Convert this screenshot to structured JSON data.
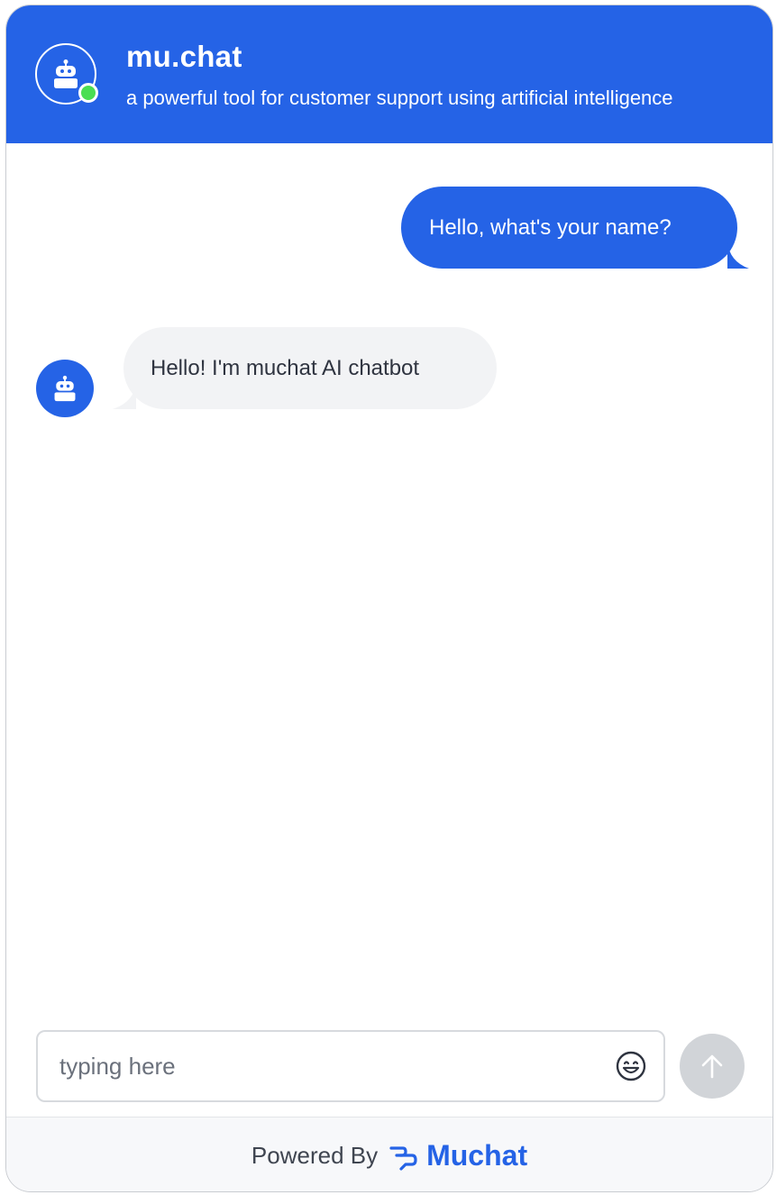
{
  "header": {
    "title": "mu.chat",
    "subtitle": "a powerful tool for customer support using artificial intelligence",
    "avatar_icon": "robot-icon",
    "status_icon": "online-status-dot"
  },
  "messages": [
    {
      "sender": "user",
      "text": "Hello, what's your name?"
    },
    {
      "sender": "bot",
      "text": "Hello! I'm muchat AI chatbot",
      "avatar_icon": "robot-icon"
    }
  ],
  "composer": {
    "placeholder": "typing here",
    "value": "",
    "emoji_icon": "emoji-icon",
    "send_icon": "arrow-up-icon"
  },
  "footer": {
    "powered_label": "Powered By",
    "brand_name": "Muchat",
    "brand_icon": "muchat-logo-icon"
  },
  "colors": {
    "primary": "#2563e6",
    "online": "#4ade52",
    "bot_bubble": "#f2f3f5",
    "send_disabled": "#d1d4d8"
  }
}
